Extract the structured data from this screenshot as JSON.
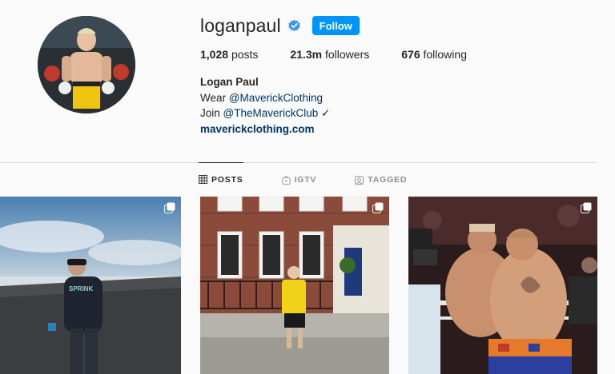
{
  "profile": {
    "username": "loganpaul",
    "follow_label": "Follow",
    "stats": [
      {
        "value": "1,028",
        "label": "posts"
      },
      {
        "value": "21.3m",
        "label": "followers"
      },
      {
        "value": "676",
        "label": "following"
      }
    ],
    "bio": {
      "name": "Logan Paul",
      "line1_prefix": "Wear ",
      "line1_mention": "@MaverickClothing",
      "line2_prefix": "Join ",
      "line2_mention": "@TheMaverickClub",
      "line2_suffix": " ✓",
      "link": "maverickclothing.com"
    }
  },
  "tabs": [
    {
      "label": "POSTS",
      "icon": "grid-icon",
      "active": true
    },
    {
      "label": "IGTV",
      "icon": "igtv-icon",
      "active": false
    },
    {
      "label": "TAGGED",
      "icon": "tagged-icon",
      "active": false
    }
  ],
  "posts": [
    {
      "scene": "beach-walking",
      "multi": true
    },
    {
      "scene": "townhouse-street",
      "multi": true
    },
    {
      "scene": "boxing-ring-hug",
      "multi": true
    }
  ],
  "colors": {
    "accent": "#0095f6",
    "verified": "#3897f0",
    "link": "#00376b",
    "border": "#dbdbdb",
    "muted": "#8e8e8e"
  }
}
